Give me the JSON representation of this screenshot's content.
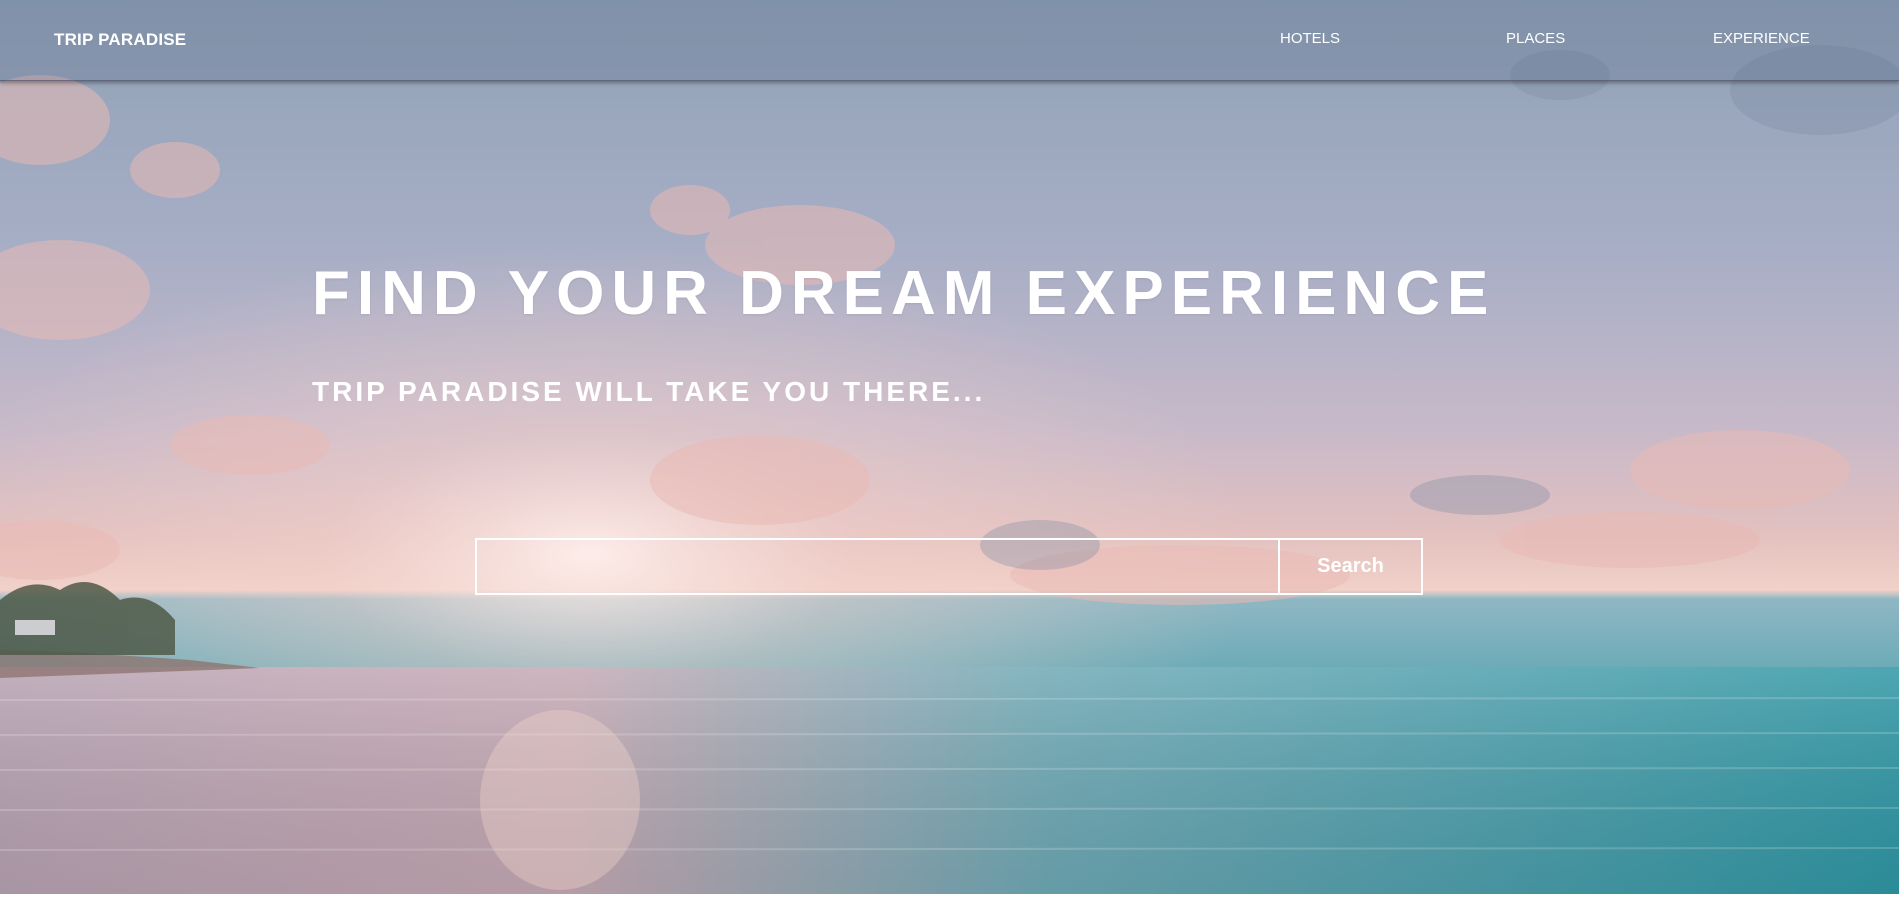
{
  "navbar": {
    "brand": "TRIP PARADISE",
    "links": [
      {
        "label": "HOTELS"
      },
      {
        "label": "PLACES"
      },
      {
        "label": "EXPERIENCE"
      }
    ]
  },
  "hero": {
    "headline": "FIND YOUR DREAM EXPERIENCE",
    "subheadline": "TRIP PARADISE WILL TAKE YOU THERE...",
    "background": "beach sunset with ocean, clouds and palm trees",
    "search": {
      "value": "",
      "placeholder": "",
      "button_label": "Search"
    }
  },
  "colors": {
    "text": "#ffffff",
    "sky": "#a7aec6",
    "sunset": "#f1d1c9",
    "ocean": "#3f9aa7"
  }
}
